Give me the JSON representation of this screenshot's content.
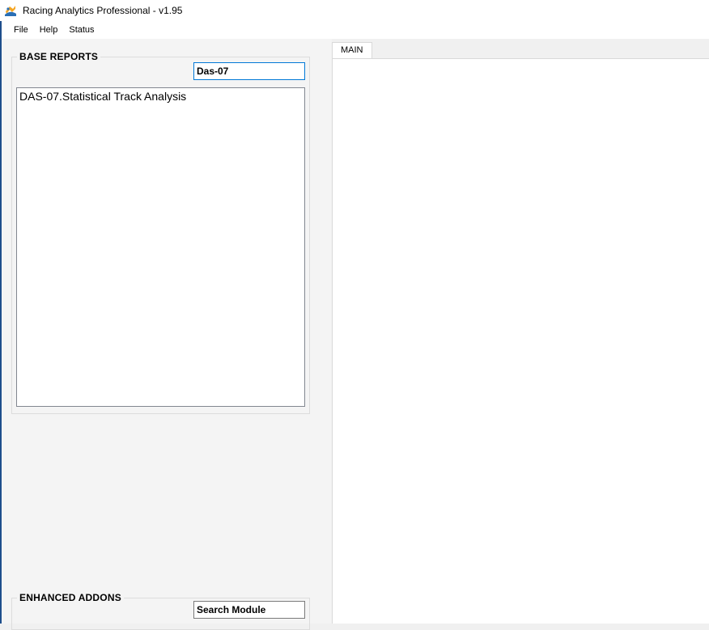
{
  "window": {
    "title": "Racing Analytics Professional - v1.95",
    "icon": "app-logo-icon"
  },
  "menu": {
    "items": [
      {
        "label": "File"
      },
      {
        "label": "Help"
      },
      {
        "label": "Status"
      }
    ]
  },
  "base_reports": {
    "title": "BASE REPORTS",
    "filter_value": "Das-07",
    "items": [
      {
        "label": "DAS-07.Statistical Track Analysis"
      }
    ]
  },
  "enhanced_addons": {
    "title": "ENHANCED ADDONS",
    "filter_value": "Search Module"
  },
  "tabs": [
    {
      "label": "MAIN",
      "active": true
    }
  ],
  "colors": {
    "accent": "#0078d7",
    "window_edge": "#1e4e8c",
    "pane_bg": "#f4f4f4"
  }
}
